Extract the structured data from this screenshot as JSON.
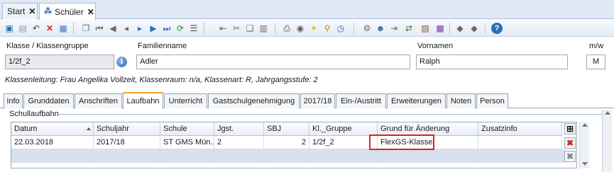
{
  "tabs": [
    {
      "label": "Start",
      "close": "✕"
    },
    {
      "label": "Schüler",
      "close": "✕"
    }
  ],
  "toolbar": {
    "icons": [
      "new-icon",
      "save-icon",
      "undo-icon",
      "delete-icon",
      "print-list-icon",
      "copy-icon",
      "first-icon",
      "prev-page-icon",
      "prev-icon",
      "next-icon",
      "next-page-icon",
      "last-icon",
      "refresh-icon",
      "list-icon",
      "arrow-left-icon",
      "cut-icon",
      "copy-doc-icon",
      "paste-icon",
      "printer-icon",
      "preview-icon",
      "bulb-icon",
      "search-icon",
      "clock-icon",
      "settings-icon",
      "user-icon",
      "export-icon",
      "import-icon",
      "photo-icon",
      "flag-icon",
      "flag2-icon",
      "help-icon"
    ]
  },
  "form": {
    "klasse_label": "Klasse / Klassengruppe",
    "klasse_value": "1/2f_2",
    "info_icon": "i",
    "familienname_label": "Familienname",
    "familienname_value": "Adler",
    "vornamen_label": "Vornamen",
    "vornamen_value": "Ralph",
    "mw_label": "m/w",
    "mw_value": "M",
    "info_line": "Klassenleitung: Frau Angelika Vollzeit, Klassenraum: n/a, Klassenart: R, Jahrgangsstufe: 2"
  },
  "sub_tabs": [
    "Info",
    "Grunddaten",
    "Anschriften",
    "Laufbahn",
    "Unterricht",
    "Gastschulgenehmigung",
    "2017/18",
    "Ein-/Austritt",
    "Erweiterungen",
    "Noten",
    "Person"
  ],
  "active_sub_tab": "Laufbahn",
  "group": {
    "title": "Schullaufbahn"
  },
  "grid": {
    "columns": [
      "Datum",
      "Schuljahr",
      "Schule",
      "Jgst.",
      "SBJ",
      "Kl._Gruppe",
      "Grund für Änderung",
      "Zusatzinfo"
    ],
    "rows": [
      {
        "datum": "22.03.2018",
        "schuljahr": "2017/18",
        "schule": "ST GMS Mün...",
        "jgst": "2",
        "sbj": "2",
        "kl_gruppe": "1/2f_2",
        "grund": "FlexGS-Klasse",
        "zusatzinfo": ""
      }
    ],
    "delete_glyph": "✖"
  },
  "colors": {
    "accent": "#f0a030",
    "highlight": "#e02020",
    "selected_row": "#d7e1ef"
  }
}
